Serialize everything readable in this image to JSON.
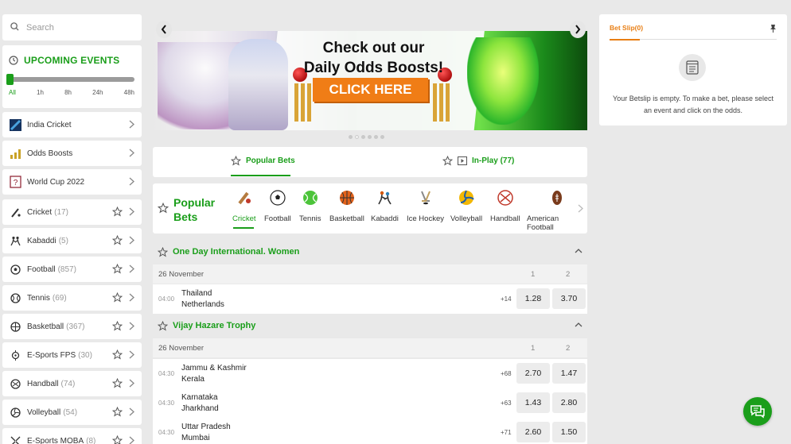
{
  "search": {
    "placeholder": "Search"
  },
  "upcoming": {
    "title": "UPCOMING EVENTS",
    "ticks": [
      "All",
      "1h",
      "8h",
      "24h",
      "48h"
    ],
    "slider_value": "All"
  },
  "quick_links": [
    {
      "label": "India Cricket",
      "icon": "india-flag-icon"
    },
    {
      "label": "Odds Boosts",
      "icon": "odds-boost-icon"
    },
    {
      "label": "World Cup 2022",
      "icon": "world-cup-icon"
    }
  ],
  "sports_list": [
    {
      "label": "Cricket",
      "count": "(17)",
      "icon": "cricket-bat-icon"
    },
    {
      "label": "Kabaddi",
      "count": "(5)",
      "icon": "kabaddi-icon"
    },
    {
      "label": "Football",
      "count": "(857)",
      "icon": "football-icon"
    },
    {
      "label": "Tennis",
      "count": "(69)",
      "icon": "tennis-icon"
    },
    {
      "label": "Basketball",
      "count": "(367)",
      "icon": "basketball-icon"
    },
    {
      "label": "E-Sports FPS",
      "count": "(30)",
      "icon": "esports-fps-icon"
    },
    {
      "label": "Handball",
      "count": "(74)",
      "icon": "handball-icon"
    },
    {
      "label": "Volleyball",
      "count": "(54)",
      "icon": "volleyball-icon"
    },
    {
      "label": "E-Sports MOBA",
      "count": "(8)",
      "icon": "esports-moba-icon"
    }
  ],
  "banner": {
    "line1": "Check out our",
    "line2": "Daily Odds Boosts!",
    "cta": "CLICK HERE",
    "slides": 6,
    "active_slide": 2
  },
  "tabs": {
    "popular": "Popular Bets",
    "inplay": "In-Play (77)"
  },
  "popular_bar": {
    "title_line1": "Popular",
    "title_line2": "Bets",
    "sports": [
      {
        "label": "Cricket",
        "color": "#c0392b"
      },
      {
        "label": "Football",
        "color": "#222222"
      },
      {
        "label": "Tennis",
        "color": "#2db52d"
      },
      {
        "label": "Basketball",
        "color": "#e2621b"
      },
      {
        "label": "Kabaddi",
        "color": "#d35400"
      },
      {
        "label": "Ice Hockey",
        "color": "#999999"
      },
      {
        "label": "Volleyball",
        "color": "#f2b705"
      },
      {
        "label": "Handball",
        "color": "#c0392b"
      },
      {
        "label": "American Football",
        "color": "#7a3b1c"
      }
    ]
  },
  "leagues": [
    {
      "name": "One Day International. Women",
      "date": "26 November",
      "col1": "1",
      "col2": "2",
      "matches": [
        {
          "time": "04:00",
          "team1": "Thailand",
          "team2": "Netherlands",
          "more": "+14",
          "odd1": "1.28",
          "odd2": "3.70"
        }
      ]
    },
    {
      "name": "Vijay Hazare Trophy",
      "date": "26 November",
      "col1": "1",
      "col2": "2",
      "matches": [
        {
          "time": "04:30",
          "team1": "Jammu & Kashmir",
          "team2": "Kerala",
          "more": "+68",
          "odd1": "2.70",
          "odd2": "1.47"
        },
        {
          "time": "04:30",
          "team1": "Karnataka",
          "team2": "Jharkhand",
          "more": "+63",
          "odd1": "1.43",
          "odd2": "2.80"
        },
        {
          "time": "04:30",
          "team1": "Uttar Pradesh",
          "team2": "Mumbai",
          "more": "+71",
          "odd1": "2.60",
          "odd2": "1.50"
        }
      ]
    }
  ],
  "betslip": {
    "title": "Bet Slip",
    "count": "(0)",
    "message": "Your Betslip is empty. To make a bet, please select an event and click on the odds."
  },
  "colors": {
    "accent": "#1a9e1a",
    "betslip_accent": "#e87e13",
    "cta": "#f07d16"
  }
}
